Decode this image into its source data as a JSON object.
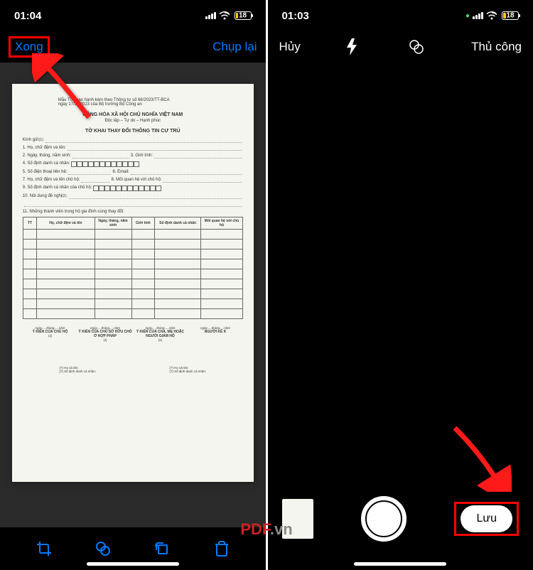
{
  "left": {
    "status": {
      "time": "01:04",
      "battery": "18"
    },
    "nav": {
      "done": "Xong",
      "retake": "Chụp lại"
    },
    "document": {
      "meta_line1": "T01 ban hành kèm theo Thông tư số 66/2023/TT-BCA",
      "meta_line2": "ngày 17/11/2023 của Bộ trưởng Bộ Công an",
      "republic": "CỘNG HÒA XÃ HỘI CHỦ NGHĨA VIỆT NAM",
      "motto": "Độc lập – Tự do – Hạnh phúc",
      "form_title": "TỜ KHAI THAY ĐỔI THÔNG TIN CƯ TRÚ",
      "greeting": "Kính gửi",
      "field1": "1. Họ, chữ đệm và tên:",
      "field2": "2. Ngày, tháng, năm sinh:",
      "field3": "3. Giới tính:",
      "field4": "4. Số định danh cá nhân:",
      "field5": "5. Số điện thoại liên hệ:",
      "field6": "6. Email:",
      "field7": "7. Họ, chữ đệm và tên chủ hộ:",
      "field8": "8. Mối quan hệ với chủ hộ:",
      "field9": "9. Số định danh cá nhân của chủ hộ:",
      "field10": "10. Nội dung đề nghị",
      "field11": "11. Những thành viên trong hộ gia đình cùng thay đổi:",
      "table": {
        "col_tt": "TT",
        "col_name": "Họ, chữ đệm và tên",
        "col_dob": "Ngày, tháng, năm sinh",
        "col_gender": "Giới tính",
        "col_id": "Số định danh cá nhân",
        "col_rel": "Mối quan hệ với chủ hộ"
      },
      "sig_date": "ngày.....tháng.....năm",
      "sig1_title": "Ý KIẾN CỦA CHỦ HỘ",
      "sig2_title": "Ý KIẾN CỦA CHỦ SỞ HỮU CHỖ Ở HỢP PHÁP",
      "sig3_title": "Ý KIẾN CỦA CHA, MẸ HOẶC NGƯỜI GIÁM HỘ",
      "sig4_title": "NGƯỜI KÊ K",
      "footer1": "(7) Họ và tên:",
      "footer2": "(7) Số định danh cá nhân:"
    }
  },
  "right": {
    "status": {
      "time": "01:03",
      "battery": "18"
    },
    "camera": {
      "cancel": "Hủy",
      "manual": "Thủ công",
      "save": "Lưu"
    }
  },
  "watermark": {
    "pdf": "PDF",
    "vn": ".vn"
  }
}
